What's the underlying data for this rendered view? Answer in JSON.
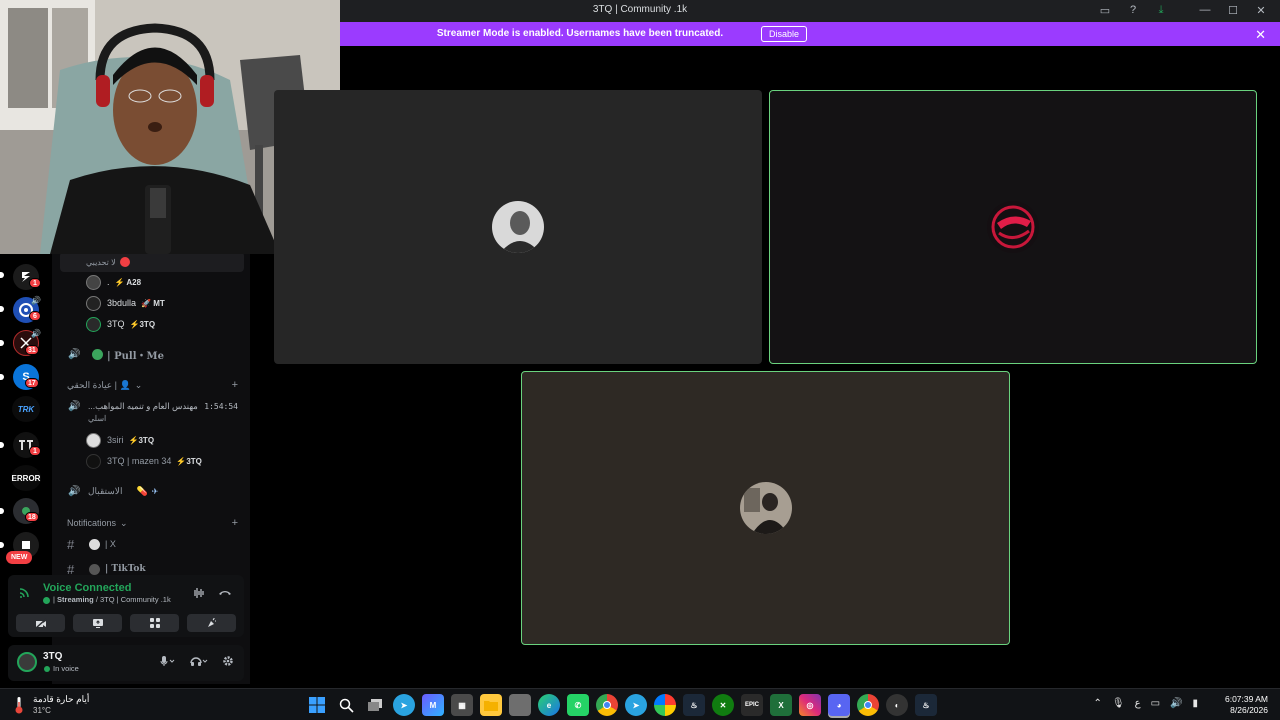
{
  "window": {
    "title": "3TQ | Community .1k"
  },
  "banner": {
    "text": "Streamer Mode is enabled. Usernames have been truncated.",
    "button_label": "Disable",
    "color": "#9b3bff"
  },
  "servers": {
    "badges": [
      "1",
      "6",
      "31",
      "17",
      "1",
      "18"
    ],
    "labels": [
      "TRK",
      "ERROR"
    ],
    "new_label": "NEW"
  },
  "sidebar": {
    "top_user_label": "لا تحديبي",
    "voice_users_1": [
      {
        "name": ".",
        "tag": "⚡ A28"
      },
      {
        "name": "3bdulla",
        "tag": "🚀 MT"
      },
      {
        "name": "3TQ",
        "tag": "⚡3TQ"
      }
    ],
    "pull_channel": "| Pull・Me",
    "category_1": "عيادة الحقي | 👤",
    "voice_channel_2": "...مهندس العام و تنميه المواهب",
    "voice_channel_2_sub": "اسلي",
    "voice_channel_2_timer": "1:54:54",
    "voice_users_2": [
      {
        "name": "3siri",
        "tag": "⚡3TQ"
      },
      {
        "name": "3TQ | mazen 34",
        "tag": "⚡3TQ"
      }
    ],
    "reception_channel": "الاستقبال",
    "notifications_category": "Notifications",
    "text_channels": [
      "| X",
      "| TikTok"
    ]
  },
  "voice_panel": {
    "title": "Voice Connected",
    "subtitle_strong": "Streaming",
    "subtitle_rest": " / 3TQ | Community .1k",
    "accent": "#23a55a"
  },
  "user_panel": {
    "name": "3TQ",
    "status": "In voice"
  },
  "taskbar": {
    "weather_text": "أيام حارة قادمة",
    "weather_temp": "31°C",
    "time": "6:07:39 AM",
    "date": "8/26/2026",
    "lang": "ع"
  }
}
